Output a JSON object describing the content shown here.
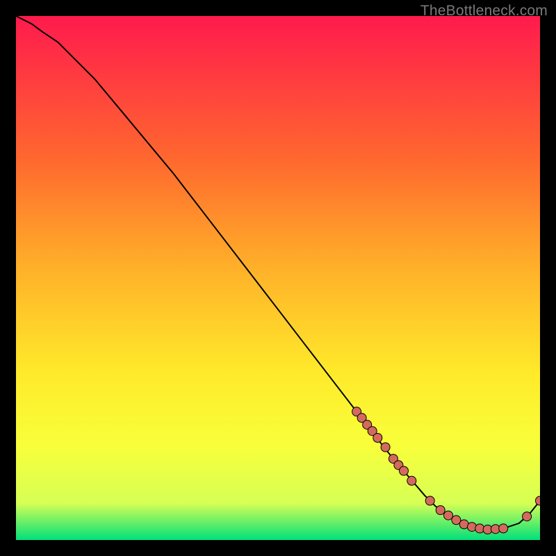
{
  "watermark": "TheBottleneck.com",
  "colors": {
    "bg": "#000000",
    "gradient_top": "#ff1a4d",
    "gradient_mid1": "#ff6a2e",
    "gradient_mid2": "#ffb029",
    "gradient_mid3": "#ffea2a",
    "gradient_mid4": "#f8ff3a",
    "gradient_mid5": "#d6ff55",
    "gradient_bottom": "#00e07a",
    "curve": "#000000",
    "marker_fill": "#d46a5e",
    "marker_stroke": "#000000"
  },
  "chart_data": {
    "type": "line",
    "title": "",
    "xlabel": "",
    "ylabel": "",
    "xlim": [
      0,
      100
    ],
    "ylim": [
      0,
      100
    ],
    "grid": false,
    "legend": false,
    "series": [
      {
        "name": "curve",
        "x": [
          0,
          3,
          5,
          8,
          10,
          15,
          20,
          25,
          30,
          35,
          40,
          45,
          50,
          55,
          60,
          65,
          70,
          72,
          75,
          78,
          80,
          82,
          85,
          88,
          90,
          93,
          96,
          98,
          100
        ],
        "y": [
          100,
          98.5,
          97,
          95,
          93,
          88,
          82,
          76,
          70,
          63.5,
          57,
          50.5,
          44,
          37.5,
          31,
          24.5,
          18,
          15.5,
          12,
          8.5,
          6.5,
          5,
          3.2,
          2.2,
          2,
          2.2,
          3.2,
          5,
          7.5
        ]
      }
    ],
    "markers": [
      {
        "x": 65.0,
        "y": 24.5
      },
      {
        "x": 66.0,
        "y": 23.3
      },
      {
        "x": 67.0,
        "y": 22.0
      },
      {
        "x": 68.0,
        "y": 20.8
      },
      {
        "x": 69.0,
        "y": 19.5
      },
      {
        "x": 70.5,
        "y": 17.7
      },
      {
        "x": 72.0,
        "y": 15.5
      },
      {
        "x": 73.0,
        "y": 14.3
      },
      {
        "x": 74.0,
        "y": 13.2
      },
      {
        "x": 75.5,
        "y": 11.3
      },
      {
        "x": 79.0,
        "y": 7.5
      },
      {
        "x": 81.0,
        "y": 5.7
      },
      {
        "x": 82.5,
        "y": 4.7
      },
      {
        "x": 84.0,
        "y": 3.8
      },
      {
        "x": 85.5,
        "y": 3.0
      },
      {
        "x": 87.0,
        "y": 2.5
      },
      {
        "x": 88.5,
        "y": 2.2
      },
      {
        "x": 90.0,
        "y": 2.0
      },
      {
        "x": 91.5,
        "y": 2.1
      },
      {
        "x": 93.0,
        "y": 2.2
      },
      {
        "x": 97.5,
        "y": 4.5
      },
      {
        "x": 100.0,
        "y": 7.5
      }
    ]
  }
}
